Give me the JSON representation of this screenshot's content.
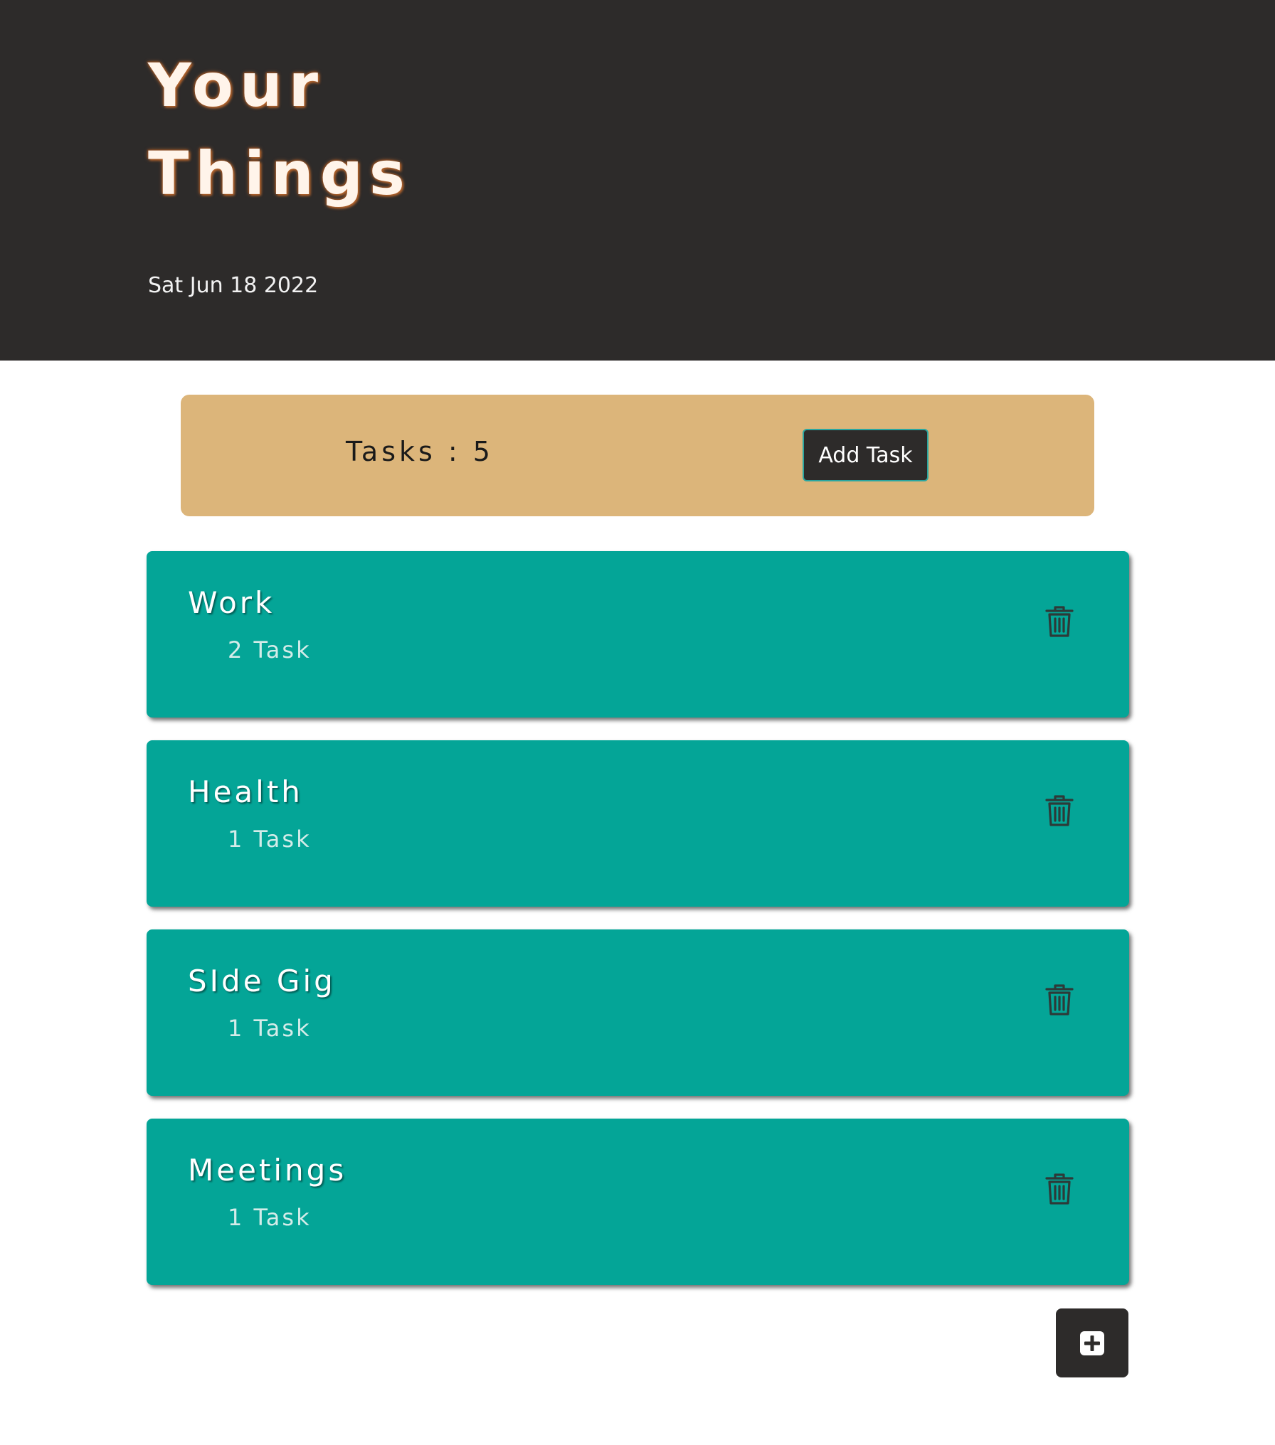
{
  "header": {
    "title_line1": "Your",
    "title_line2": "Things",
    "date": "Sat Jun 18 2022"
  },
  "summary": {
    "tasks_label": "Tasks : 5",
    "add_task_label": "Add Task"
  },
  "lists": [
    {
      "name": "Work",
      "count": "2 Task"
    },
    {
      "name": "Health",
      "count": "1 Task"
    },
    {
      "name": "SIde Gig",
      "count": "1 Task"
    },
    {
      "name": "Meetings",
      "count": "1 Task"
    }
  ],
  "icons": {
    "delete": "trash-icon",
    "add": "plus-square-icon"
  },
  "colors": {
    "header_bg": "#2d2b2a",
    "summary_bg": "#dcb57a",
    "card_bg": "#04a597",
    "button_bg": "#2d2b2a"
  }
}
